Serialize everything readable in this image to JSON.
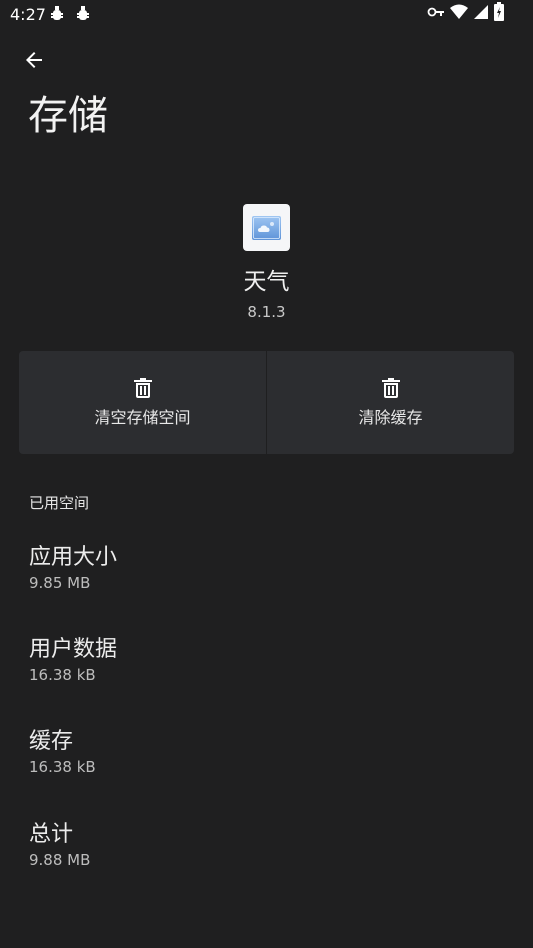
{
  "status_bar": {
    "time": "4:27",
    "icons": [
      "debug-icon",
      "debug-icon",
      "vpn-key-icon",
      "wifi-icon",
      "signal-icon",
      "battery-icon"
    ]
  },
  "header": {
    "back_icon": "arrow-left-icon",
    "title": "存储"
  },
  "app": {
    "icon": "weather-app-icon",
    "name": "天气",
    "version": "8.1.3"
  },
  "actions": [
    {
      "label": "清空存储空间",
      "icon": "trash-icon"
    },
    {
      "label": "清除缓存",
      "icon": "trash-icon"
    }
  ],
  "usage": {
    "section_title": "已用空间",
    "items": [
      {
        "label": "应用大小",
        "value": "9.85 MB"
      },
      {
        "label": "用户数据",
        "value": "16.38 kB"
      },
      {
        "label": "缓存",
        "value": "16.38 kB"
      },
      {
        "label": "总计",
        "value": "9.88 MB"
      }
    ]
  },
  "colors": {
    "background": "#1f1f20",
    "panel": "#2c2d30",
    "text_primary": "#ececec",
    "text_secondary": "#bdbdbd"
  }
}
